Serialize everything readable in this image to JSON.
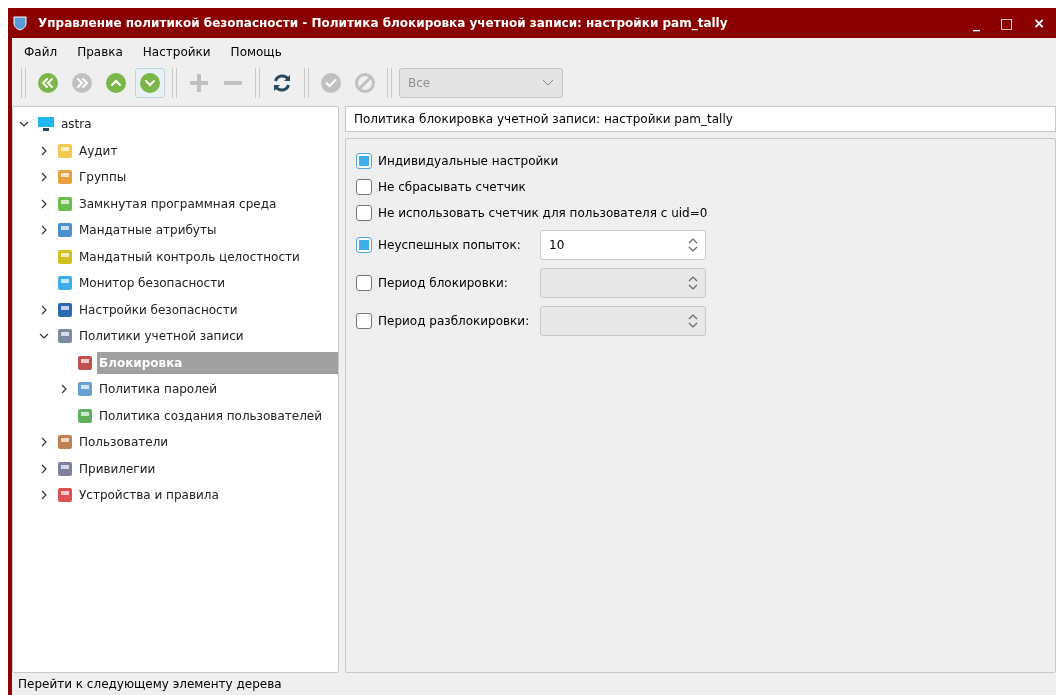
{
  "window": {
    "title": "Управление политикой безопасности - Политика блокировка учетной записи: настройки pam_tally",
    "controls": [
      "_",
      "□",
      "×"
    ]
  },
  "menu": [
    "Файл",
    "Правка",
    "Настройки",
    "Помощь"
  ],
  "toolbar": [
    {
      "kind": "first",
      "disabled": false,
      "selected": false
    },
    {
      "kind": "last",
      "disabled": true,
      "selected": false
    },
    {
      "kind": "up",
      "disabled": false,
      "selected": false
    },
    {
      "kind": "down",
      "disabled": false,
      "selected": true
    },
    {
      "kind": "sep"
    },
    {
      "kind": "add",
      "disabled": true,
      "selected": false
    },
    {
      "kind": "remove",
      "disabled": true,
      "selected": false
    },
    {
      "kind": "sep"
    },
    {
      "kind": "refresh",
      "disabled": false,
      "selected": false
    },
    {
      "kind": "sep"
    },
    {
      "kind": "apply",
      "disabled": true,
      "selected": false
    },
    {
      "kind": "cancel",
      "disabled": true,
      "selected": false
    },
    {
      "kind": "sep"
    }
  ],
  "filter": {
    "value": "Все",
    "disabled": true
  },
  "tree": [
    {
      "label": "astra",
      "expanded": true,
      "selected": false,
      "children": [
        {
          "label": "Аудит",
          "expanded": false,
          "selected": false
        },
        {
          "label": "Группы",
          "expanded": false,
          "selected": false
        },
        {
          "label": "Замкнутая программная среда",
          "expanded": false,
          "selected": false
        },
        {
          "label": "Мандатные атрибуты",
          "expanded": false,
          "selected": false
        },
        {
          "label": "Мандатный контроль целостности",
          "selected": false
        },
        {
          "label": "Монитор безопасности",
          "selected": false
        },
        {
          "label": "Настройки безопасности",
          "expanded": false,
          "selected": false
        },
        {
          "label": "Политики учетной записи",
          "expanded": true,
          "selected": false,
          "children": [
            {
              "label": "Блокировка",
              "selected": true
            },
            {
              "label": "Политика паролей",
              "expanded": false,
              "selected": false
            },
            {
              "label": "Политика создания пользователей",
              "selected": false
            }
          ]
        },
        {
          "label": "Пользователи",
          "expanded": false,
          "selected": false
        },
        {
          "label": "Привилегии",
          "expanded": false,
          "selected": false
        },
        {
          "label": "Устройства и правила",
          "expanded": false,
          "selected": false
        }
      ]
    }
  ],
  "panel": {
    "title": "Политика блокировка учетной записи: настройки pam_tally",
    "options": [
      {
        "kind": "checkbox",
        "label": "Индивидуальные настройки",
        "checked": true
      },
      {
        "kind": "checkbox",
        "label": "Не сбрасывать счетчик",
        "checked": false
      },
      {
        "kind": "checkbox",
        "label": "Не использовать счетчик для пользователя с uid=0",
        "checked": false
      },
      {
        "kind": "spin",
        "label": "Неуспешных попыток:",
        "checked": true,
        "value": "10",
        "disabled": false
      },
      {
        "kind": "spin",
        "label": "Период блокировки:",
        "checked": false,
        "disabled": true
      },
      {
        "kind": "spin",
        "label": "Период разблокировки:",
        "checked": false,
        "disabled": true
      }
    ]
  },
  "status_bar": "Перейти к следующему элементу дерева"
}
